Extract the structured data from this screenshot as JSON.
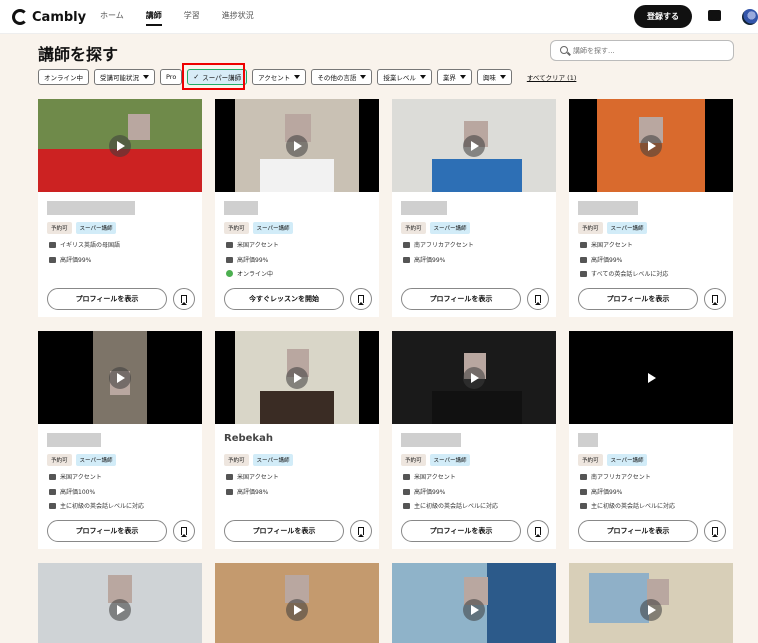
{
  "brand": "Cambly",
  "nav": [
    "ホーム",
    "講師",
    "学習",
    "進捗状況"
  ],
  "header": {
    "signup_label": "登録する"
  },
  "page_title": "講師を探す",
  "search": {
    "placeholder": "講師を探す..."
  },
  "filters": [
    {
      "label": "オンライン中",
      "dropdown": false,
      "selected": false
    },
    {
      "label": "受講可能状況",
      "dropdown": true,
      "selected": false
    },
    {
      "label": "Pro",
      "dropdown": false,
      "selected": false
    },
    {
      "label": "スーパー講師",
      "dropdown": false,
      "selected": true
    },
    {
      "label": "アクセント",
      "dropdown": true,
      "selected": false
    },
    {
      "label": "その他の言語",
      "dropdown": true,
      "selected": false
    },
    {
      "label": "授業レベル",
      "dropdown": true,
      "selected": false
    },
    {
      "label": "業界",
      "dropdown": true,
      "selected": false
    },
    {
      "label": "興味",
      "dropdown": true,
      "selected": false
    }
  ],
  "clear_all": "すべてクリア (1)",
  "badges": {
    "available": "予約可",
    "super": "スーパー講師"
  },
  "buttons": {
    "profile": "プロフィールを表示",
    "lesson_now": "今すぐレッスンを開始"
  },
  "tutors": [
    {
      "name": "",
      "accent": "イギリス英語の母国語",
      "rating": "高評価99%",
      "extra": ""
    },
    {
      "name": "",
      "accent": "米国アクセント",
      "rating": "高評価99%",
      "extra": "オンライン中"
    },
    {
      "name": "",
      "accent": "南アフリカアクセント",
      "rating": "高評価99%",
      "extra": ""
    },
    {
      "name": "",
      "accent": "米国アクセント",
      "rating": "高評価99%",
      "extra": "すべての英会話レベルに対応"
    },
    {
      "name": "",
      "accent": "米国アクセント",
      "rating": "高評価100%",
      "extra": "主に初級の英会話レベルに対応"
    },
    {
      "name": "Rebekah",
      "accent": "米国アクセント",
      "rating": "高評価98%",
      "extra": ""
    },
    {
      "name": "",
      "accent": "米国アクセント",
      "rating": "高評価99%",
      "extra": "主に初級の英会話レベルに対応"
    },
    {
      "name": "",
      "accent": "南アフリカアクセント",
      "rating": "高評価99%",
      "extra": "主に初級の英会話レベルに対応"
    }
  ],
  "icons": [
    "search-icon",
    "message-icon",
    "play-icon",
    "bookmark-icon",
    "accent-icon",
    "thumbs-up-icon",
    "level-icon"
  ]
}
